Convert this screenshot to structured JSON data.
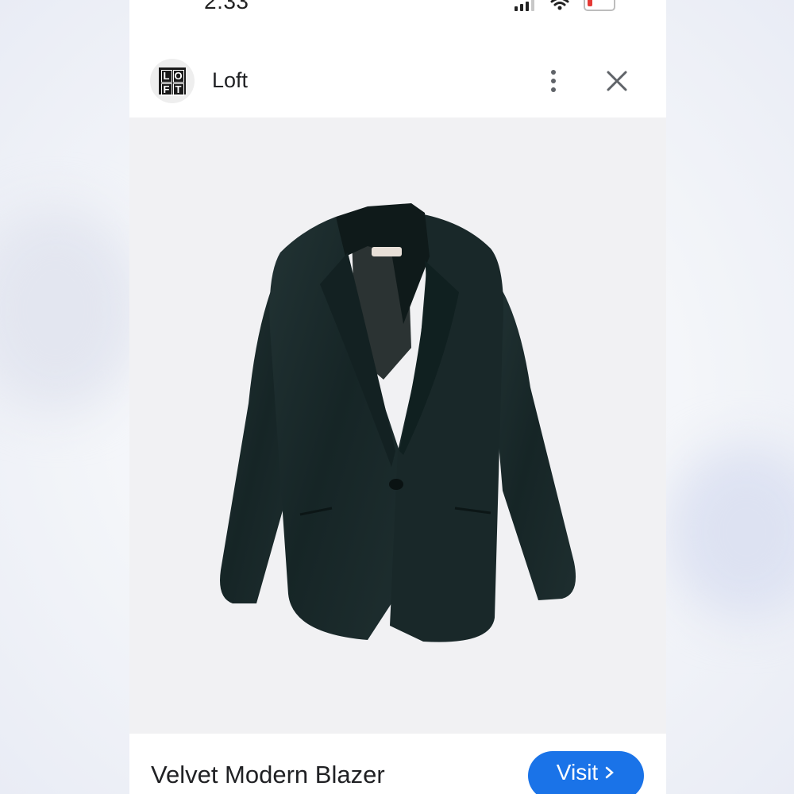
{
  "status_bar": {
    "time": "2:33",
    "icons": [
      "signal-icon",
      "wifi-icon",
      "battery-icon"
    ],
    "battery_color": "#e53935"
  },
  "header": {
    "site_name": "Loft",
    "logo_letters": [
      "L",
      "O",
      "F",
      "T"
    ],
    "icons": [
      "more-vert-icon",
      "close-icon"
    ]
  },
  "product": {
    "title": "Velvet Modern Blazer",
    "visit_label": "Visit",
    "visit_icon": "chevron-right-icon",
    "accent": "#1a73e8",
    "blazer_color": "#1b2a2b"
  }
}
